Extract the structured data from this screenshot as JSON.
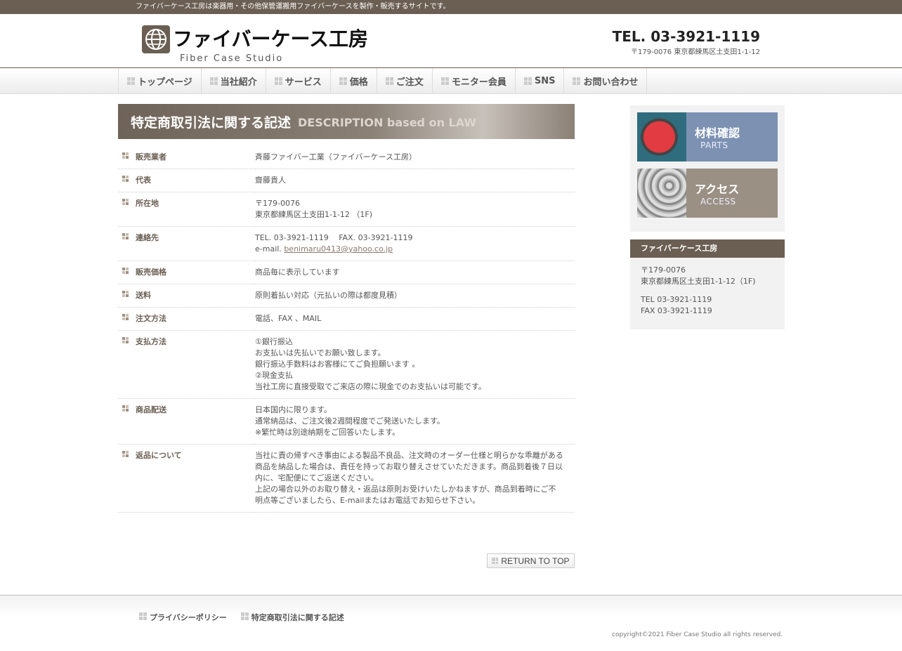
{
  "topbar": {
    "text": "ファイバーケース工房は楽器用・その他保管運搬用ファイバーケースを製作・販売するサイトです。"
  },
  "header": {
    "logo_jp": "ファイバーケース工房",
    "logo_en": "Fiber Case Studio",
    "tel": "TEL. 03-3921-1119",
    "address": "〒179-0076 東京都練馬区土支田1-1-12"
  },
  "nav": [
    "トップページ",
    "当社紹介",
    "サービス",
    "価格",
    "ご注文",
    "モニター会員",
    "SNS",
    "お問い合わせ"
  ],
  "main": {
    "title_jp": "特定商取引法に関する記述",
    "title_en": "DESCRIPTION based on LAW",
    "rows": [
      {
        "label": "販売業者",
        "lines": [
          "斉藤ファイバー工業（ファイバーケース工房）"
        ]
      },
      {
        "label": "代表",
        "lines": [
          "齋藤貴人"
        ]
      },
      {
        "label": "所在地",
        "lines": [
          "〒179-0076",
          "東京都練馬区土支田1-1-12 （1F)"
        ]
      },
      {
        "label": "連絡先",
        "lines": [
          "TEL. 03-3921-1119　 FAX. 03-3921-1119"
        ],
        "email_prefix": "e-mail. ",
        "email": "benimaru0413@yahoo.co.jp"
      },
      {
        "label": "販売価格",
        "lines": [
          "商品毎に表示しています"
        ]
      },
      {
        "label": "送料",
        "lines": [
          "原則着払い対応（元払いの際は都度見積）"
        ]
      },
      {
        "label": "注文方法",
        "lines": [
          "電話、FAX 、MAIL"
        ]
      },
      {
        "label": "支払方法",
        "lines": [
          "①銀行振込",
          "お支払いは先払いでお願い致します。",
          "銀行振込手数料はお客様にてご負担願います 。",
          "②現金支払",
          "当社工房に直接受取でご来店の際に現金でのお支払いは可能です。"
        ]
      },
      {
        "label": "商品配送",
        "lines": [
          "日本国内に限ります。",
          "通常納品は、ご注文後2週間程度でご発送いたします。",
          "※繁忙時は別途納期をご回答いたします。"
        ]
      },
      {
        "label": "返品について",
        "lines": [
          "当社に責の帰すべき事由による製品不良品、注文時のオーダー仕様と明らかな乖離がある商品を納品した場合は、責任を持ってお取り替えさせていただきます。商品到着後７日以内に、宅配便にてご返送ください。",
          "上記の場合以外のお取り替え・返品は原則お受けいたしかねますが、商品到着時にご不明点等ございましたら、E-mailまたはお電話でお知らせ下さい。"
        ]
      }
    ],
    "return_to_top": "RETURN TO TOP"
  },
  "side": {
    "banner1": {
      "title": "材料確認",
      "sub": "PARTS"
    },
    "banner2": {
      "title": "アクセス",
      "sub": "ACCESS"
    },
    "info_head": "ファイバーケース工房",
    "info_postal": "〒179-0076",
    "info_address": "東京都練馬区土支田1-1-12（1F)",
    "info_tel": "TEL 03-3921-1119",
    "info_fax": "FAX 03-3921-1119"
  },
  "footer": {
    "links": [
      "プライバシーポリシー",
      "特定商取引法に関する記述"
    ],
    "copyright": "copyright©2021 Fiber Case Studio all rights reserved."
  }
}
